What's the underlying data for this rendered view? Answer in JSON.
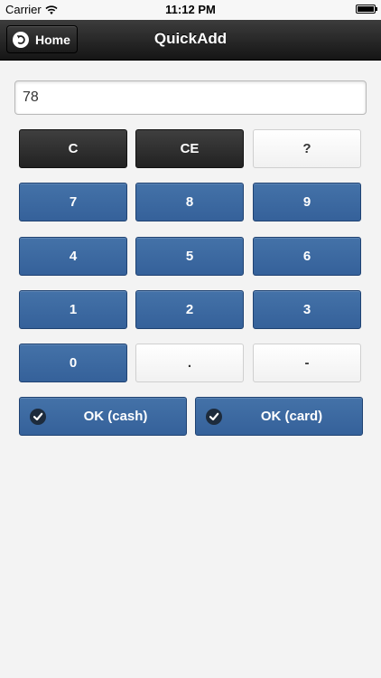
{
  "status_bar": {
    "carrier": "Carrier",
    "time": "11:12 PM",
    "icons": [
      "wifi-icon",
      "battery-icon"
    ]
  },
  "nav": {
    "title": "QuickAdd",
    "home_label": "Home",
    "home_icon": "back-arrow-icon"
  },
  "display": {
    "value": "78"
  },
  "keys": {
    "clear": "C",
    "clear_entry": "CE",
    "help": "?",
    "seven": "7",
    "eight": "8",
    "nine": "9",
    "four": "4",
    "five": "5",
    "six": "6",
    "one": "1",
    "two": "2",
    "three": "3",
    "zero": "0",
    "decimal": ".",
    "minus": "-"
  },
  "actions": {
    "ok_cash": "OK (cash)",
    "ok_card": "OK (card)",
    "icon": "check-icon"
  },
  "colors": {
    "key_blue": "#3a67a0",
    "key_dark": "#2b2b2b",
    "key_light": "#f7f7f7",
    "nav_bg": "#1e1e1e"
  }
}
